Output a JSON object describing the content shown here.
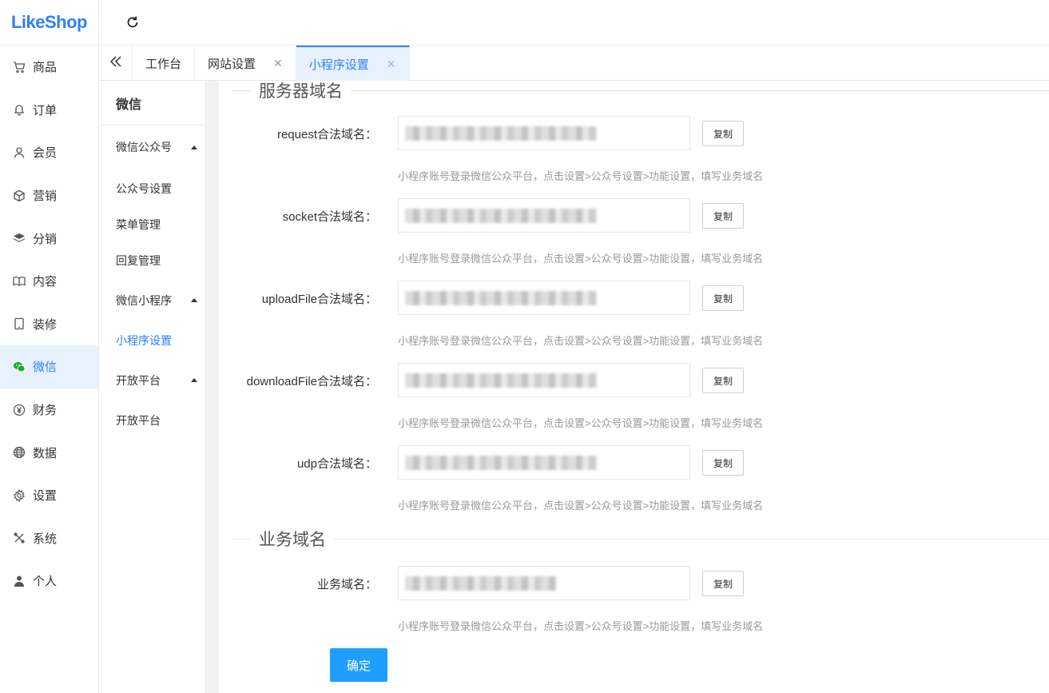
{
  "logo": "LikeShop",
  "sidebar": {
    "items": [
      {
        "label": "商品",
        "icon": "cart-icon"
      },
      {
        "label": "订单",
        "icon": "bell-icon"
      },
      {
        "label": "会员",
        "icon": "user-icon"
      },
      {
        "label": "营销",
        "icon": "cube-icon"
      },
      {
        "label": "分销",
        "icon": "layers-icon"
      },
      {
        "label": "内容",
        "icon": "book-icon"
      },
      {
        "label": "装修",
        "icon": "tablet-icon"
      },
      {
        "label": "微信",
        "icon": "wechat-icon"
      },
      {
        "label": "财务",
        "icon": "yen-icon"
      },
      {
        "label": "数据",
        "icon": "globe-icon"
      },
      {
        "label": "设置",
        "icon": "gear-icon"
      },
      {
        "label": "系统",
        "icon": "tools-icon"
      },
      {
        "label": "个人",
        "icon": "person-icon"
      }
    ],
    "active_index": 7
  },
  "tabs": [
    {
      "label": "工作台",
      "closable": false
    },
    {
      "label": "网站设置",
      "closable": true
    },
    {
      "label": "小程序设置",
      "closable": true
    }
  ],
  "subnav": {
    "title": "微信",
    "group1": "微信公众号",
    "group1_items": [
      "公众号设置",
      "菜单管理",
      "回复管理"
    ],
    "group2": "微信小程序",
    "group2_items": [
      "小程序设置"
    ],
    "group3": "开放平台",
    "group3_items": [
      "开放平台"
    ]
  },
  "sections": {
    "server_domain": "服务器域名",
    "business_domain": "业务域名"
  },
  "fields": [
    {
      "label": "request合法域名：",
      "copy": "复制",
      "hint": "小程序账号登录微信公众平台，点击设置>公众号设置>功能设置，填写业务域名"
    },
    {
      "label": "socket合法域名：",
      "copy": "复制",
      "hint": "小程序账号登录微信公众平台，点击设置>公众号设置>功能设置，填写业务域名"
    },
    {
      "label": "uploadFile合法域名：",
      "copy": "复制",
      "hint": "小程序账号登录微信公众平台，点击设置>公众号设置>功能设置，填写业务域名"
    },
    {
      "label": "downloadFile合法域名：",
      "copy": "复制",
      "hint": "小程序账号登录微信公众平台，点击设置>公众号设置>功能设置，填写业务域名"
    },
    {
      "label": "udp合法域名：",
      "copy": "复制",
      "hint": "小程序账号登录微信公众平台，点击设置>公众号设置>功能设置，填写业务域名"
    }
  ],
  "business_field": {
    "label": "业务域名：",
    "copy": "复制",
    "hint": "小程序账号登录微信公众平台，点击设置>公众号设置>功能设置，填写业务域名"
  },
  "confirm_label": "确定",
  "colors": {
    "accent": "#2d7ff9",
    "button": "#1e9fff",
    "wechat": "#1aad19"
  }
}
